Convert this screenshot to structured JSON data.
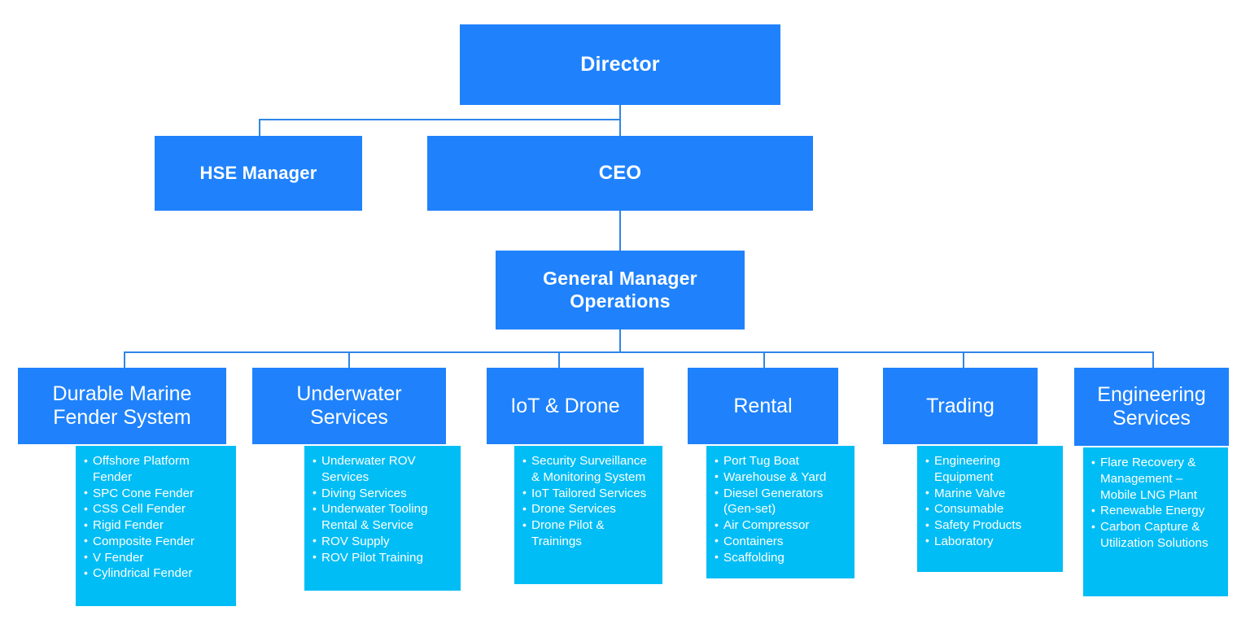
{
  "theme": {
    "primary_blue": "#1f82fc",
    "accent_cyan": "#00bdf5",
    "connector_blue": "#2f86e8",
    "background": "#ffffff",
    "text_on_fill": "#ffffff"
  },
  "executives": {
    "director": "Director",
    "hse_manager": "HSE Manager",
    "ceo": "CEO",
    "general_manager": "General Manager Operations"
  },
  "departments": [
    {
      "title": "Durable Marine Fender System",
      "items": [
        "Offshore Platform Fender",
        "SPC Cone Fender",
        "CSS Cell Fender",
        "Rigid Fender",
        "Composite Fender",
        "V Fender",
        "Cylindrical Fender"
      ]
    },
    {
      "title": "Underwater Services",
      "items": [
        "Underwater ROV Services",
        "Diving Services",
        "Underwater Tooling Rental & Service",
        "ROV Supply",
        "ROV Pilot Training"
      ]
    },
    {
      "title": "IoT & Drone",
      "items": [
        "Security Surveillance & Monitoring System",
        "IoT Tailored Services",
        "Drone Services",
        "Drone Pilot & Trainings"
      ]
    },
    {
      "title": "Rental",
      "items": [
        "Port Tug Boat",
        "Warehouse & Yard",
        "Diesel Generators (Gen-set)",
        "Air Compressor",
        "Containers",
        "Scaffolding"
      ]
    },
    {
      "title": "Trading",
      "items": [
        "Engineering Equipment",
        "Marine Valve",
        "Consumable",
        "Safety Products",
        "Laboratory"
      ]
    },
    {
      "title": "Engineering Services",
      "items": [
        "Flare Recovery & Management – Mobile LNG Plant",
        "Renewable Energy",
        "Carbon Capture & Utilization Solutions"
      ]
    }
  ]
}
